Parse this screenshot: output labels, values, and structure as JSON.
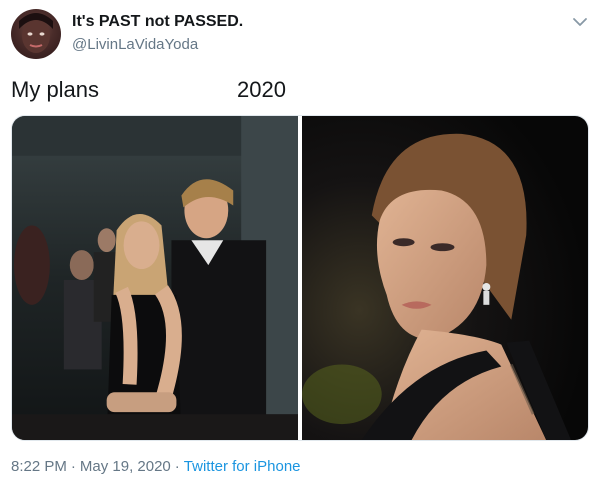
{
  "user": {
    "display_name": "It's PAST not PASSED.",
    "handle": "@LivinLaVidaYoda"
  },
  "tweet": {
    "caption_left": "My plans",
    "caption_right": "2020",
    "time": "8:22 PM",
    "date": "May 19, 2020",
    "separator": "·",
    "source": "Twitter for iPhone"
  },
  "icons": {
    "avatar": "avatar-photo",
    "menu": "chevron-down-icon"
  },
  "colors": {
    "text": "#14171a",
    "secondary": "#657786",
    "link": "#1b95e0"
  }
}
